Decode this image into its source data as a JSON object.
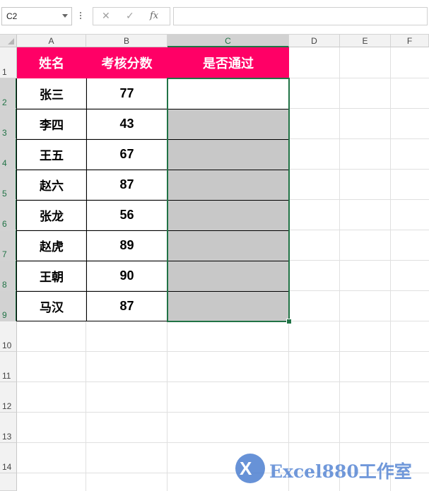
{
  "formula_bar": {
    "name_box": "C2",
    "cancel_glyph": "✕",
    "enter_glyph": "✓",
    "fx_glyph": "fx",
    "formula": ""
  },
  "columns": [
    "A",
    "B",
    "C",
    "D",
    "E",
    "F"
  ],
  "rows": [
    "1",
    "2",
    "3",
    "4",
    "5",
    "6",
    "7",
    "8",
    "9",
    "10",
    "11",
    "12",
    "13",
    "14"
  ],
  "table": {
    "headers": [
      "姓名",
      "考核分数",
      "是否通过"
    ],
    "rows": [
      {
        "name": "张三",
        "score": "77",
        "pass": ""
      },
      {
        "name": "李四",
        "score": "43",
        "pass": ""
      },
      {
        "name": "王五",
        "score": "67",
        "pass": ""
      },
      {
        "name": "赵六",
        "score": "87",
        "pass": ""
      },
      {
        "name": "张龙",
        "score": "56",
        "pass": ""
      },
      {
        "name": "赵虎",
        "score": "89",
        "pass": ""
      },
      {
        "name": "王朝",
        "score": "90",
        "pass": ""
      },
      {
        "name": "马汉",
        "score": "87",
        "pass": ""
      }
    ]
  },
  "colors": {
    "header_fill": "#ff0066",
    "selection": "#217346",
    "gray_fill": "#c8c8c8"
  },
  "watermark": {
    "logo_letter": "X",
    "text": "Excel880工作室"
  }
}
